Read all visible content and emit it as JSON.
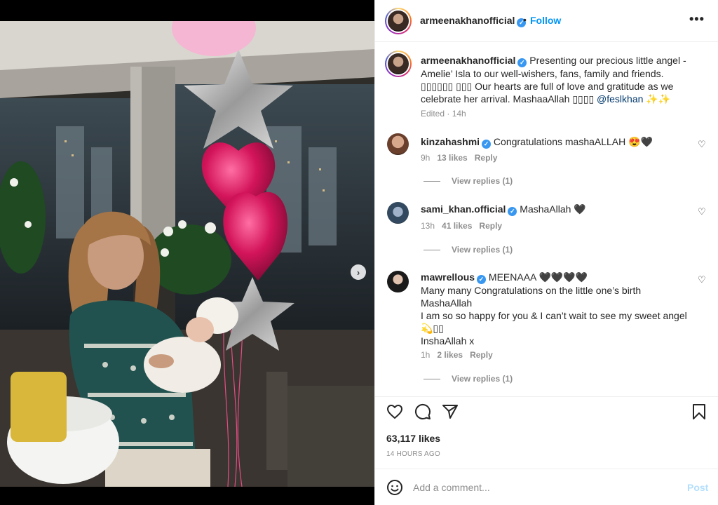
{
  "post": {
    "username": "armeenakhanofficial",
    "separator": "•",
    "follow_label": "Follow",
    "more_label": "•••"
  },
  "caption": {
    "username": "armeenakhanofficial",
    "text_part1": "Presenting our precious little angel - Amelie’ Isla to our well-wishers, fans, family and friends. ▯▯▯▯▯▯ ▯▯▯ Our hearts are full of love and gratitude as we celebrate her arrival. MashaaAllah ▯▯▯▯",
    "mention": "@feslkhan",
    "text_part2": "✨✨",
    "meta": "Edited · 14h"
  },
  "comments": [
    {
      "username": "kinzahashmi",
      "verified": true,
      "text": "Congratulations mashaALLAH 😍🖤",
      "time": "9h",
      "likes": "13 likes",
      "reply_label": "Reply",
      "view_replies": "View replies (1)"
    },
    {
      "username": "sami_khan.official",
      "verified": true,
      "text": "MashaAllah 🖤",
      "time": "13h",
      "likes": "41 likes",
      "reply_label": "Reply",
      "view_replies": "View replies (1)"
    },
    {
      "username": "mawrellous",
      "verified": true,
      "text_line1": "MEENAAA 🖤🖤🖤🖤",
      "text_line2": "Many many Congratulations on the little one’s birth",
      "text_line3": "MashaAllah",
      "text_line4": "I am so so happy for you & I can’t wait to see my sweet angel",
      "text_line5": "💫▯▯",
      "text_line6": "InshaAllah x",
      "time": "1h",
      "likes": "2 likes",
      "reply_label": "Reply",
      "view_replies": "View replies (1)"
    }
  ],
  "actions": {
    "like_icon": "heart-outline-icon",
    "comment_icon": "speech-bubble-icon",
    "share_icon": "paper-plane-icon",
    "save_icon": "bookmark-icon",
    "likes_count": "63,117 likes",
    "time_ago": "14 HOURS AGO"
  },
  "add_comment": {
    "emoji_icon": "smiley-icon",
    "placeholder": "Add a comment...",
    "post_label": "Post"
  },
  "carousel": {
    "next_icon": "chevron-right-icon",
    "current_index": 1,
    "total": 3
  },
  "colors": {
    "accent_blue": "#0095f6",
    "verified_blue": "#3897f0",
    "muted_text": "#8e8e8e",
    "post_disabled": "#b2dffc"
  }
}
